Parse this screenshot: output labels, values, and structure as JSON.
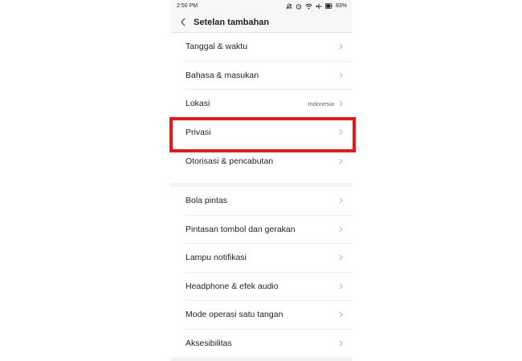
{
  "status_bar": {
    "time": "2:50 PM",
    "battery": "83%",
    "icons": [
      "bell-off-icon",
      "alarm-icon",
      "wifi-icon",
      "airplane-icon",
      "battery-icon"
    ]
  },
  "header": {
    "title": "Setelan tambahan",
    "back_icon": "chevron-left-icon"
  },
  "sections": [
    {
      "items": [
        {
          "label": "Tanggal & waktu",
          "value": ""
        },
        {
          "label": "Bahasa & masukan",
          "value": ""
        },
        {
          "label": "Lokasi",
          "value": "Indonesia"
        },
        {
          "label": "Privasi",
          "value": ""
        },
        {
          "label": "Otorisasi & pencabutan",
          "value": ""
        }
      ]
    },
    {
      "items": [
        {
          "label": "Bola pintas",
          "value": ""
        },
        {
          "label": "Pintasan tombol dan gerakan",
          "value": ""
        },
        {
          "label": "Lampu notifikasi",
          "value": ""
        },
        {
          "label": "Headphone & efek audio",
          "value": ""
        },
        {
          "label": "Mode operasi satu tangan",
          "value": ""
        },
        {
          "label": "Aksesibilitas",
          "value": ""
        }
      ]
    }
  ],
  "highlighted_item": "Privasi",
  "colors": {
    "highlight": "#e81818",
    "background": "#ffffff",
    "header_bg": "#f7f7f7",
    "divider": "#f2f2f2"
  }
}
